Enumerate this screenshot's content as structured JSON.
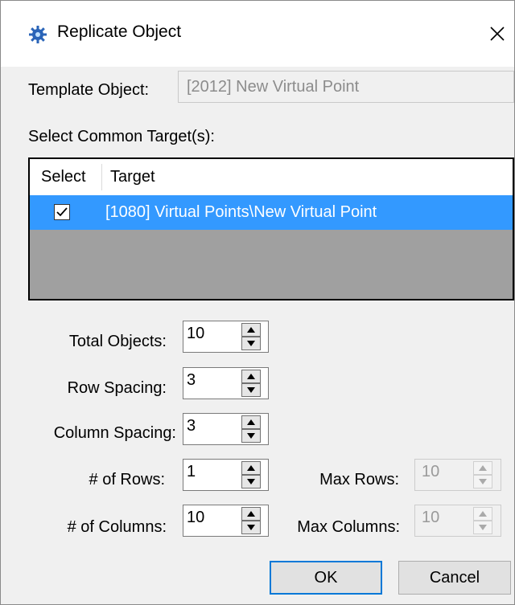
{
  "dialog": {
    "title": "Replicate Object",
    "close_glyph": "✕"
  },
  "template": {
    "label": "Template Object:",
    "value": "[2012] New Virtual Point"
  },
  "targets": {
    "label": "Select Common Target(s):",
    "columns": [
      "Select",
      "Target"
    ],
    "rows": [
      {
        "selected": true,
        "check_glyph": "✓",
        "target": "[1080] Virtual Points\\New Virtual Point"
      }
    ]
  },
  "fields": {
    "total_objects": {
      "label": "Total Objects:",
      "value": "10"
    },
    "row_spacing": {
      "label": "Row Spacing:",
      "value": "3"
    },
    "column_spacing": {
      "label": "Column Spacing:",
      "value": "3"
    },
    "num_rows": {
      "label": "# of Rows:",
      "value": "1"
    },
    "num_columns": {
      "label": "# of Columns:",
      "value": "10"
    },
    "max_rows": {
      "label": "Max Rows:",
      "value": "10",
      "disabled": true
    },
    "max_columns": {
      "label": "Max Columns:",
      "value": "10",
      "disabled": true
    }
  },
  "buttons": {
    "ok": "OK",
    "cancel": "Cancel"
  },
  "colors": {
    "selection": "#3399ff",
    "default_button_border": "#0078d7",
    "grid_empty": "#a0a0a0"
  },
  "icons": {
    "title": "gear-icon",
    "close": "close-icon",
    "spin_up": "arrow-up-icon",
    "spin_down": "arrow-down-icon"
  }
}
